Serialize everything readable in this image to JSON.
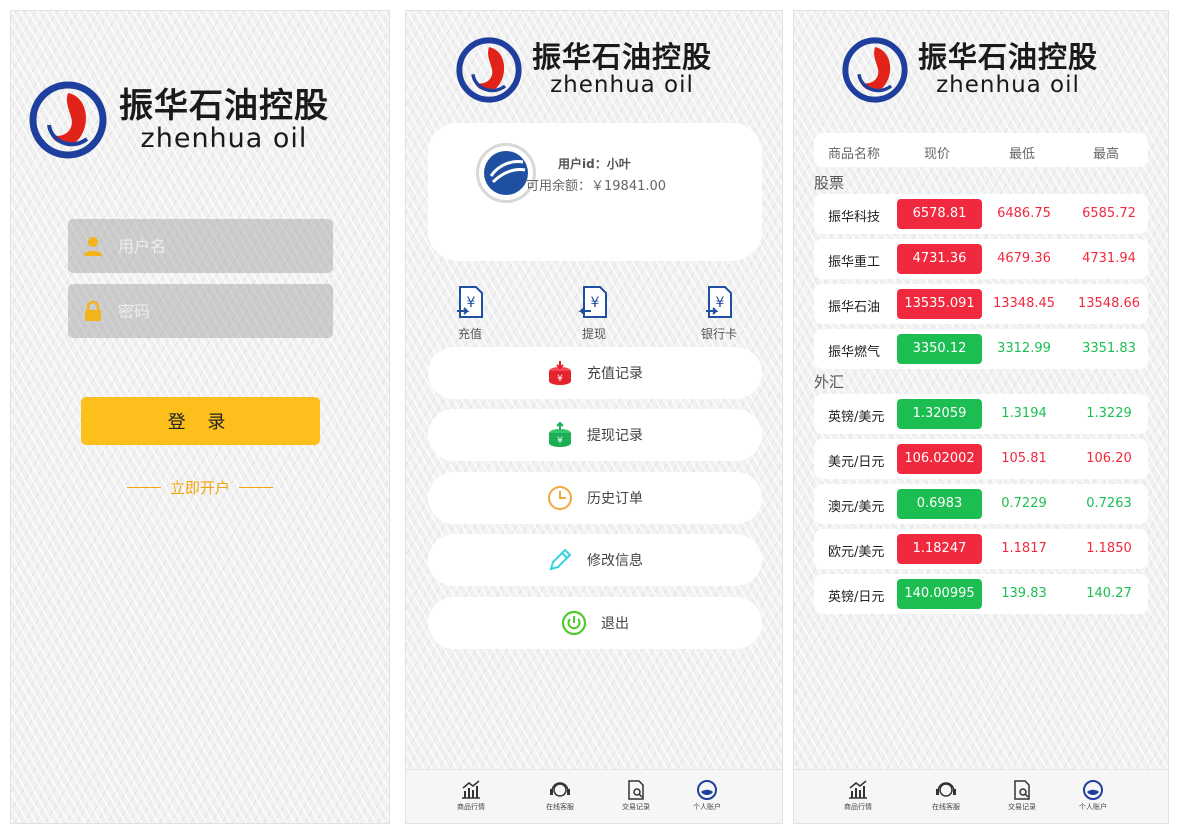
{
  "brand": {
    "cn": "振华石油控股",
    "en": "zhenhua oil"
  },
  "colors": {
    "accent": "#fdbf1c",
    "up": "#f1293e",
    "down": "#1cbe51",
    "link": "#f0a50f"
  },
  "login": {
    "username_placeholder": "用户名",
    "password_placeholder": "密码",
    "login_button": "登 录",
    "register_link": "立即开户"
  },
  "account": {
    "user_id": "用户id：小叶",
    "balance": "可用余额：￥19841.00",
    "quick_actions": [
      {
        "label": "充值",
        "icon": "recharge-icon"
      },
      {
        "label": "提现",
        "icon": "withdraw-icon"
      },
      {
        "label": "银行卡",
        "icon": "bank-card-icon"
      }
    ],
    "menu": [
      {
        "label": "充值记录",
        "icon": "recharge-record-icon"
      },
      {
        "label": "提现记录",
        "icon": "withdraw-record-icon"
      },
      {
        "label": "历史订单",
        "icon": "clock-icon"
      },
      {
        "label": "修改信息",
        "icon": "pencil-icon"
      },
      {
        "label": "退出",
        "icon": "power-icon"
      }
    ]
  },
  "tabbar": [
    {
      "label": "商品行情",
      "icon": "chart-icon"
    },
    {
      "label": "在线客服",
      "icon": "headset-icon"
    },
    {
      "label": "交易记录",
      "icon": "document-search-icon"
    },
    {
      "label": "个人账户",
      "icon": "account-icon"
    }
  ],
  "quotes": {
    "headers": {
      "name": "商品名称",
      "price": "现价",
      "low": "最低",
      "high": "最高"
    },
    "stocks_title": "股票",
    "forex_title": "外汇",
    "stocks": [
      {
        "name": "振华科技",
        "price": "6578.81",
        "low": "6486.75",
        "high": "6585.72",
        "trend": "up"
      },
      {
        "name": "振华重工",
        "price": "4731.36",
        "low": "4679.36",
        "high": "4731.94",
        "trend": "up"
      },
      {
        "name": "振华石油",
        "price": "13535.091",
        "low": "13348.45",
        "high": "13548.66",
        "trend": "up"
      },
      {
        "name": "振华燃气",
        "price": "3350.12",
        "low": "3312.99",
        "high": "3351.83",
        "trend": "down"
      }
    ],
    "forex": [
      {
        "name": "英镑/美元",
        "price": "1.32059",
        "low": "1.3194",
        "high": "1.3229",
        "trend": "down"
      },
      {
        "name": "美元/日元",
        "price": "106.02002",
        "low": "105.81",
        "high": "106.20",
        "trend": "up"
      },
      {
        "name": "澳元/美元",
        "price": "0.6983",
        "low": "0.7229",
        "high": "0.7263",
        "trend": "down"
      },
      {
        "name": "欧元/美元",
        "price": "1.18247",
        "low": "1.1817",
        "high": "1.1850",
        "trend": "up"
      },
      {
        "name": "英镑/日元",
        "price": "140.00995",
        "low": "139.83",
        "high": "140.27",
        "trend": "down"
      }
    ]
  }
}
